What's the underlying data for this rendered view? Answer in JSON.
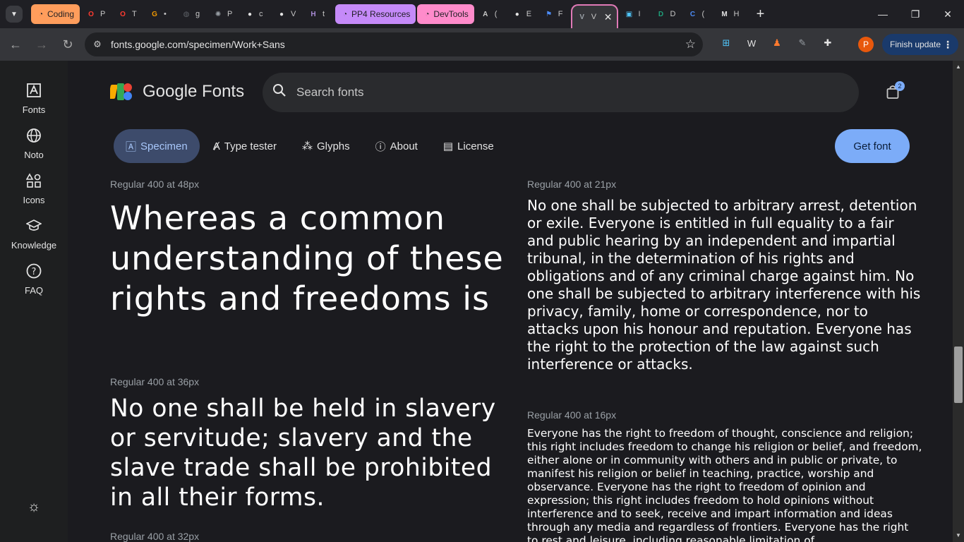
{
  "browser": {
    "tabs": [
      {
        "label": "Coding",
        "kind": "group",
        "color": "#ff9d5c",
        "text": "#1f1f24"
      },
      {
        "label": "P",
        "icon": "opera-icon",
        "color": "#ff3b30"
      },
      {
        "label": "T",
        "icon": "opera-icon",
        "color": "#ff3b30"
      },
      {
        "label": "•",
        "icon": "g-icon",
        "color": "#f29900"
      },
      {
        "label": "g",
        "icon": "globe-icon",
        "color": "#5f6368"
      },
      {
        "label": "P",
        "icon": "chatgpt-icon",
        "color": "#9aa0a6"
      },
      {
        "label": "c",
        "icon": "github-icon",
        "color": "#e3e3e3"
      },
      {
        "label": "V",
        "icon": "github-icon",
        "color": "#e3e3e3"
      },
      {
        "label": "t",
        "icon": "h-icon",
        "color": "#a98bd6"
      },
      {
        "label": "PP4 Resources",
        "kind": "group",
        "color": "#c58af9",
        "text": "#1f1f24"
      },
      {
        "label": "DevTools",
        "kind": "group",
        "color": "#ff8bcb",
        "text": "#1f1f24"
      },
      {
        "label": "(",
        "icon": "a-icon",
        "color": "#c7c7c7"
      },
      {
        "label": "E",
        "icon": "github-icon",
        "color": "#e3e3e3"
      },
      {
        "label": "F",
        "icon": "flag-icon",
        "color": "#4c8bf5"
      },
      {
        "label": "V",
        "icon": "v-icon",
        "color": "#9aa0a6",
        "active": true
      },
      {
        "label": "I",
        "icon": "screen-icon",
        "color": "#4fc3f7"
      },
      {
        "label": "D",
        "icon": "d-icon",
        "color": "#1fa07a"
      },
      {
        "label": "(",
        "icon": "c-icon",
        "color": "#4c8bf5"
      },
      {
        "label": "H",
        "icon": "m-icon",
        "color": "#e3e3e3"
      }
    ],
    "new_tab_label": "+",
    "url": "fonts.google.com/specimen/Work+Sans",
    "profile_initial": "P",
    "finish_update_label": "Finish update"
  },
  "rail": {
    "items": [
      {
        "label": "Fonts",
        "icon": "fonts-icon"
      },
      {
        "label": "Noto",
        "icon": "globe-icon"
      },
      {
        "label": "Icons",
        "icon": "shapes-icon"
      },
      {
        "label": "Knowledge",
        "icon": "graduation-cap-icon"
      },
      {
        "label": "FAQ",
        "icon": "help-icon"
      }
    ]
  },
  "header": {
    "logo_text": "Google Fonts",
    "search_placeholder": "Search fonts",
    "bag_count": "2"
  },
  "nav": {
    "tabs": [
      {
        "label": "Specimen",
        "selected": true
      },
      {
        "label": "Type tester"
      },
      {
        "label": "Glyphs"
      },
      {
        "label": "About"
      },
      {
        "label": "License"
      }
    ],
    "get_font_label": "Get font"
  },
  "specimens": {
    "s48": {
      "label": "Regular 400 at 48px",
      "text": "Whereas a common understanding of these rights and freedoms is"
    },
    "s36": {
      "label": "Regular 400 at 36px",
      "text": "No one shall be held in slavery or servitude; slavery and the slave trade shall be prohibited in all their forms."
    },
    "s32": {
      "label": "Regular 400 at 32px"
    },
    "s21": {
      "label": "Regular 400 at 21px",
      "text": "No one shall be subjected to arbitrary arrest, detention or exile. Everyone is entitled in full equality to a fair and public hearing by an independent and impartial tribunal, in the determination of his rights and obligations and of any criminal charge against him. No one shall be subjected to arbitrary interference with his privacy, family, home or correspondence, nor to attacks upon his honour and reputation. Everyone has the right to the protection of the law against such interference or attacks."
    },
    "s16": {
      "label": "Regular 400 at 16px",
      "text": "Everyone has the right to freedom of thought, conscience and religion; this right includes freedom to change his religion or belief, and freedom, either alone or in community with others and in public or private, to manifest his religion or belief in teaching, practice, worship and observance. Everyone has the right to freedom of opinion and expression; this right includes freedom to hold opinions without interference and to seek, receive and impart information and ideas through any media and regardless of frontiers. Everyone has the right to rest and leisure, including reasonable limitation of"
    }
  },
  "colors": {
    "accent": "#7cacf8",
    "selected_tab_bg": "#3d4b6b",
    "page_bg": "#1b1b1f"
  }
}
